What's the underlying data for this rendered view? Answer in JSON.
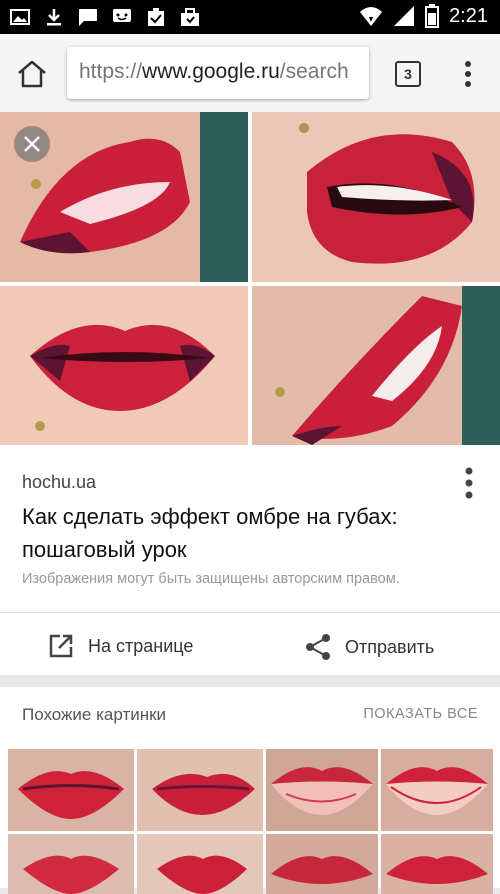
{
  "status_bar": {
    "time": "2:21",
    "left_icons": [
      "gallery-icon",
      "download-icon",
      "message-icon",
      "chat-icon",
      "clipboard-check-icon",
      "briefcase-icon"
    ],
    "right_icons": [
      "wifi-icon",
      "signal-icon",
      "battery-icon"
    ]
  },
  "toolbar": {
    "url_prefix": "https://",
    "url_domain": "www.google.ru",
    "url_suffix": "/search",
    "tab_count": "3"
  },
  "result": {
    "source": "hochu.ua",
    "title": "Как сделать эффект омбре на губах: пошаговый урок",
    "copyright_note": "Изображения могут быть защищены авторским правом.",
    "action_visit": "На странице",
    "action_share": "Отправить"
  },
  "similar": {
    "heading": "Похожие картинки",
    "show_all": "ПОКАЗАТЬ ВСЕ"
  },
  "colors": {
    "lip_red": "#d0213b",
    "lip_dark": "#6a1637",
    "skin": "#e9c2b2"
  }
}
